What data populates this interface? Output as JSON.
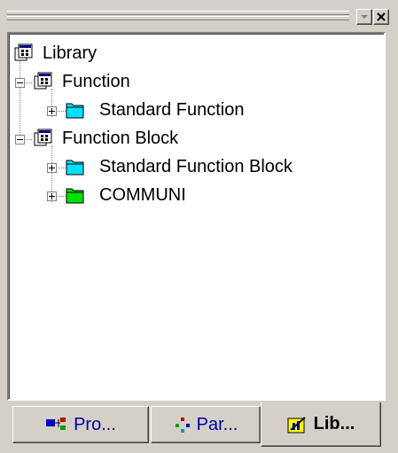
{
  "window": {
    "restore_glyph": "▾",
    "close_glyph": "×"
  },
  "tree": {
    "root": {
      "label": "Library",
      "icon": "library-icon"
    },
    "items": [
      {
        "label": "Function",
        "icon": "function-group-icon",
        "expanded": true
      },
      {
        "label": "Standard Function",
        "icon": "folder-icon",
        "color": "#00e0ff",
        "expanded": false
      },
      {
        "label": "Function Block",
        "icon": "function-group-icon",
        "expanded": true
      },
      {
        "label": "Standard Function Block",
        "icon": "folder-icon",
        "color": "#00e0ff",
        "expanded": false
      },
      {
        "label": "COMMUNI",
        "icon": "folder-icon",
        "color": "#00e000",
        "expanded": false
      }
    ]
  },
  "tabs": [
    {
      "label": "Pro...",
      "icon": "project-icon",
      "active": false
    },
    {
      "label": "Par...",
      "icon": "parameter-icon",
      "active": false
    },
    {
      "label": "Lib...",
      "icon": "library-book-icon",
      "active": true
    }
  ]
}
